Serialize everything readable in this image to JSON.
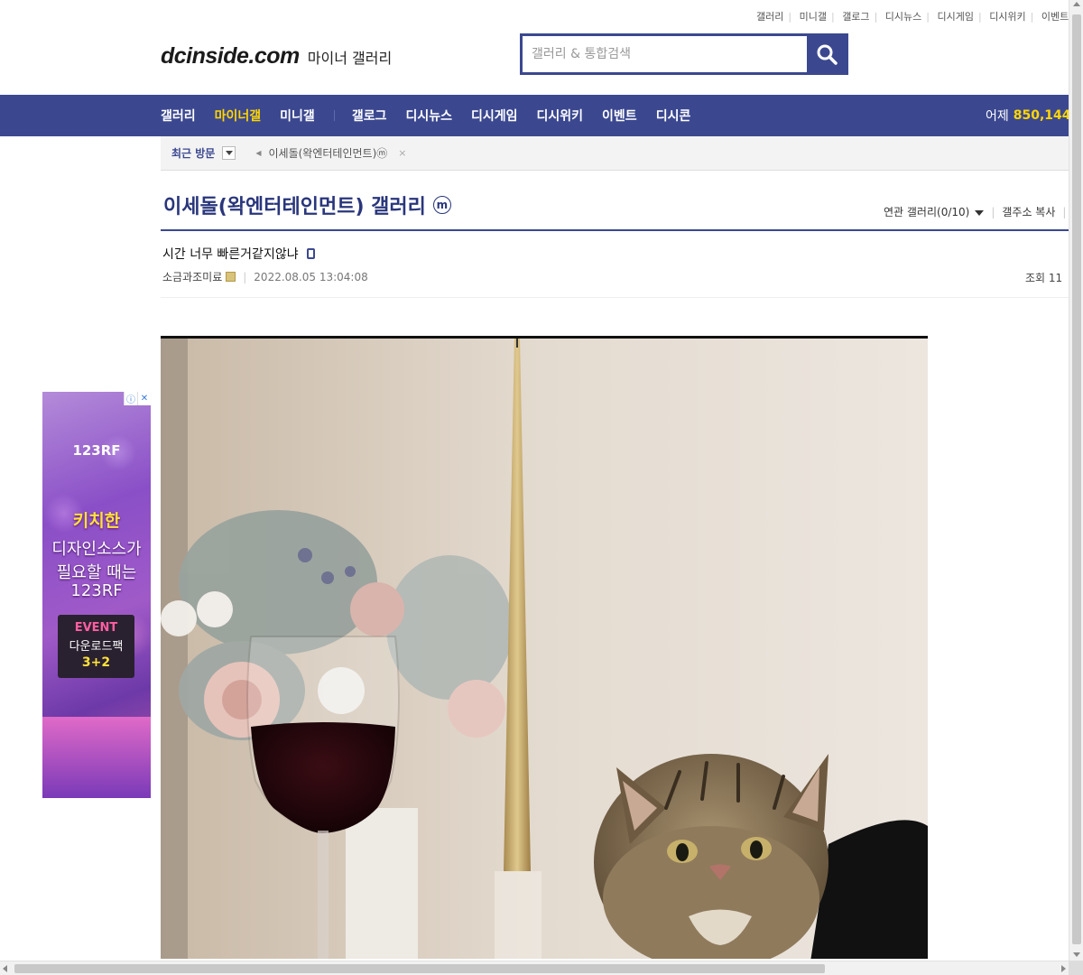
{
  "util_links": [
    "갤러리",
    "미니갤",
    "갤로그",
    "디시뉴스",
    "디시게임",
    "디시위키",
    "이벤트"
  ],
  "logo": {
    "main": "dcinside.com",
    "sub": "마이너 갤러리"
  },
  "search": {
    "placeholder": "갤러리 & 통합검색"
  },
  "gnb": {
    "items_a": [
      "갤러리",
      "마이너갤",
      "미니갤"
    ],
    "items_b": [
      "갤로그",
      "디시뉴스",
      "디시게임",
      "디시위키",
      "이벤트",
      "디시콘"
    ],
    "active": "마이너갤",
    "visit_label": "어제",
    "visit_count": "850,144"
  },
  "recent": {
    "label": "최근 방문",
    "item": "이세돌(왁엔터테인먼트)ⓜ",
    "close": "×"
  },
  "gallery": {
    "title": "이세돌(왁엔터테인먼트) 갤러리",
    "badge": "m",
    "related": "연관 갤러리(0/10)",
    "copy_address": "갤주소 복사"
  },
  "post": {
    "title": "시간 너무 빠른거같지않냐",
    "author": "소금과조미료",
    "date": "2022.08.05 13:04:08",
    "views": "조회 11"
  },
  "ad": {
    "brand": "123RF",
    "headline": "키치한",
    "lines": [
      "디자인소스가",
      "필요할 때는",
      "123RF"
    ],
    "event_title": "EVENT",
    "event_line": "다운로드팩",
    "event_offer": "3+2"
  },
  "colors": {
    "brand": "#3b4890",
    "accent": "#ffd600",
    "title": "#29367c"
  }
}
